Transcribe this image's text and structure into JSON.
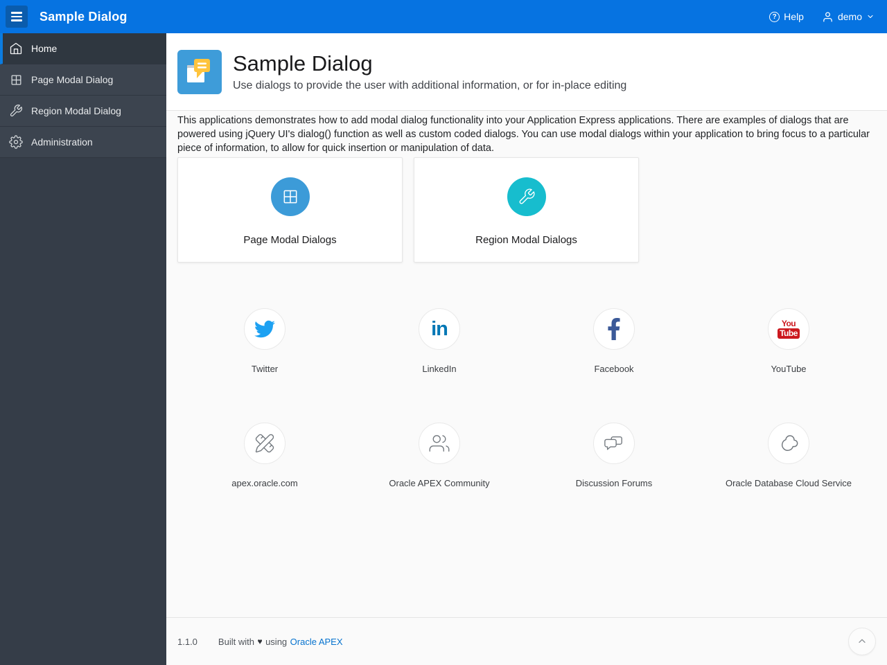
{
  "header": {
    "app_title": "Sample Dialog",
    "help_label": "Help",
    "help_glyph": "?",
    "user_name": "demo"
  },
  "sidebar": {
    "items": [
      {
        "label": "Home",
        "icon": "home-icon",
        "active": true
      },
      {
        "label": "Page Modal Dialog",
        "icon": "grid-icon",
        "active": false
      },
      {
        "label": "Region Modal Dialog",
        "icon": "wrench-icon",
        "active": false
      },
      {
        "label": "Administration",
        "icon": "gear-icon",
        "active": false
      }
    ]
  },
  "page_header": {
    "title": "Sample Dialog",
    "subtitle": "Use dialogs to provide the user with additional information, or for in-place editing"
  },
  "intro": "This applications demonstrates how to add modal dialog functionality into your Application Express applications. There are examples of dialogs that are powered using jQuery UI's dialog() function as well as custom coded dialogs. You can use modal dialogs within your application to bring focus to a particular piece of information, to allow for quick insertion or manipulation of data.",
  "cards": [
    {
      "label": "Page Modal Dialogs",
      "icon": "grid-icon",
      "accent": "#3C9BD8"
    },
    {
      "label": "Region Modal Dialogs",
      "icon": "wrench-icon",
      "accent": "#17BDCE"
    }
  ],
  "quick_links": [
    {
      "label": "Twitter",
      "icon": "twitter-icon"
    },
    {
      "label": "LinkedIn",
      "icon": "linkedin-icon"
    },
    {
      "label": "Facebook",
      "icon": "facebook-icon"
    },
    {
      "label": "YouTube",
      "icon": "youtube-icon"
    },
    {
      "label": "apex.oracle.com",
      "icon": "pencil-ruler-icon"
    },
    {
      "label": "Oracle APEX Community",
      "icon": "users-icon"
    },
    {
      "label": "Discussion Forums",
      "icon": "chat-bubbles-icon"
    },
    {
      "label": "Oracle Database Cloud Service",
      "icon": "cloud-icon"
    }
  ],
  "brand_glyphs": {
    "linkedin": "in",
    "youtube_top": "You",
    "youtube_bottom": "Tube"
  },
  "footer": {
    "version": "1.1.0",
    "built_with": "Built with",
    "heart": "♥",
    "using": "using",
    "link": "Oracle APEX"
  },
  "colors": {
    "header_bar": "#0673E1",
    "hamburger_bg": "#0A5CAD",
    "sidebar_bg": "#353D48",
    "sidebar_item_bg": "#3C444F",
    "sidebar_active_bg": "#2F3740",
    "active_indicator": "#0B7CE0",
    "page_modal_circle": "#3C9BD8",
    "region_modal_circle": "#17BDCE",
    "twitter": "#1DA1F2",
    "linkedin": "#0077B5",
    "facebook": "#3B5998",
    "youtube": "#CC181E",
    "link_text": "#0572CE",
    "content_bg": "#FAFAFA"
  }
}
